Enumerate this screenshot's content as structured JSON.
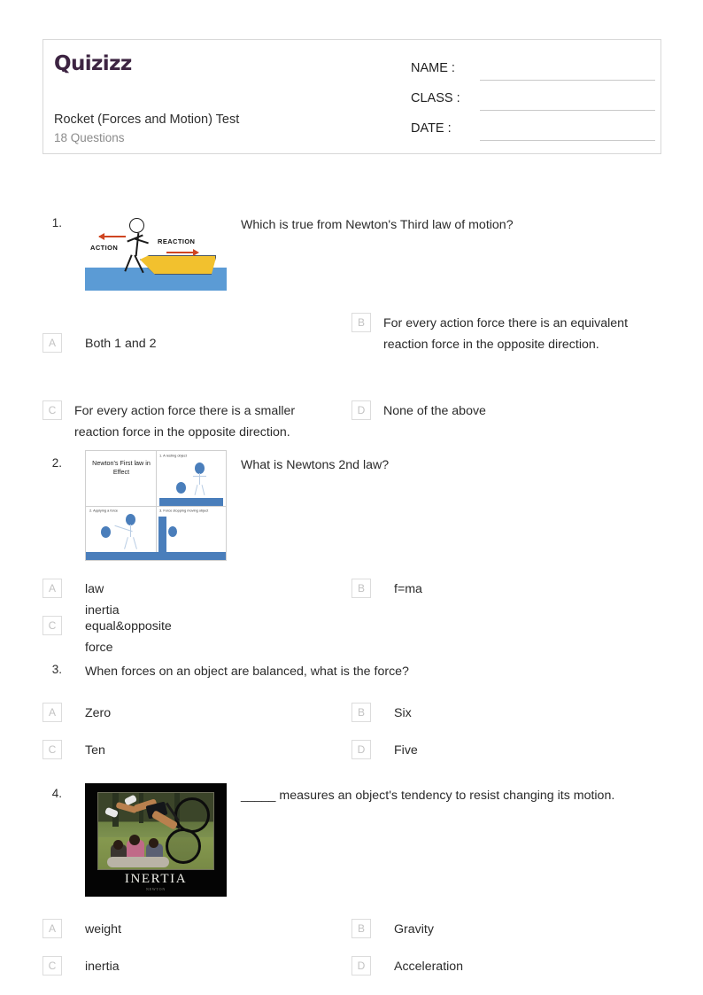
{
  "header": {
    "logo_text": "Quizizz",
    "logo_color": "#3d2442",
    "quiz_title": "Rocket (Forces and Motion) Test",
    "question_count": "18 Questions",
    "fields": [
      {
        "label": "NAME :",
        "value": ""
      },
      {
        "label": "CLASS :",
        "value": ""
      },
      {
        "label": "DATE  :",
        "value": ""
      }
    ]
  },
  "questions": [
    {
      "number": "1.",
      "text": "Which is true from Newton's Third law of motion?",
      "image": {
        "name": "action-reaction-boat-illustration",
        "label_action": "ACTION",
        "label_reaction": "REACTION"
      },
      "options": [
        {
          "letter": "A",
          "text": "Both 1 and 2"
        },
        {
          "letter": "B",
          "text": "For every action force there is an equivalent reaction force in the opposite direction."
        },
        {
          "letter": "C",
          "text": "For every action force there is a smaller reaction force in the opposite direction."
        },
        {
          "letter": "D",
          "text": "None of the above"
        }
      ]
    },
    {
      "number": "2.",
      "text": "What is Newtons 2nd law?",
      "image": {
        "name": "newtons-first-law-four-panel-illustration",
        "title": "Newton's First law in Effect",
        "panel_captions": [
          "",
          "1. A resting object",
          "2. Applying a force",
          "3. Force stopping moving object"
        ]
      },
      "options": [
        {
          "letter": "A",
          "text": "law inertia"
        },
        {
          "letter": "B",
          "text": "f=ma"
        },
        {
          "letter": "C",
          "text": "equal&opposite force"
        }
      ]
    },
    {
      "number": "3.",
      "text": "When forces on an object are balanced, what is the force?",
      "image": null,
      "options": [
        {
          "letter": "A",
          "text": "Zero"
        },
        {
          "letter": "B",
          "text": "Six"
        },
        {
          "letter": "C",
          "text": "Ten"
        },
        {
          "letter": "D",
          "text": "Five"
        }
      ]
    },
    {
      "number": "4.",
      "text": "_____ measures an object's tendency to resist changing its motion.",
      "image": {
        "name": "inertia-poster-image",
        "caption": "INERTIA",
        "subcaption": "NEWTON"
      },
      "options": [
        {
          "letter": "A",
          "text": "weight"
        },
        {
          "letter": "B",
          "text": "Gravity"
        },
        {
          "letter": "C",
          "text": "inertia"
        },
        {
          "letter": "D",
          "text": "Acceleration"
        }
      ]
    }
  ]
}
